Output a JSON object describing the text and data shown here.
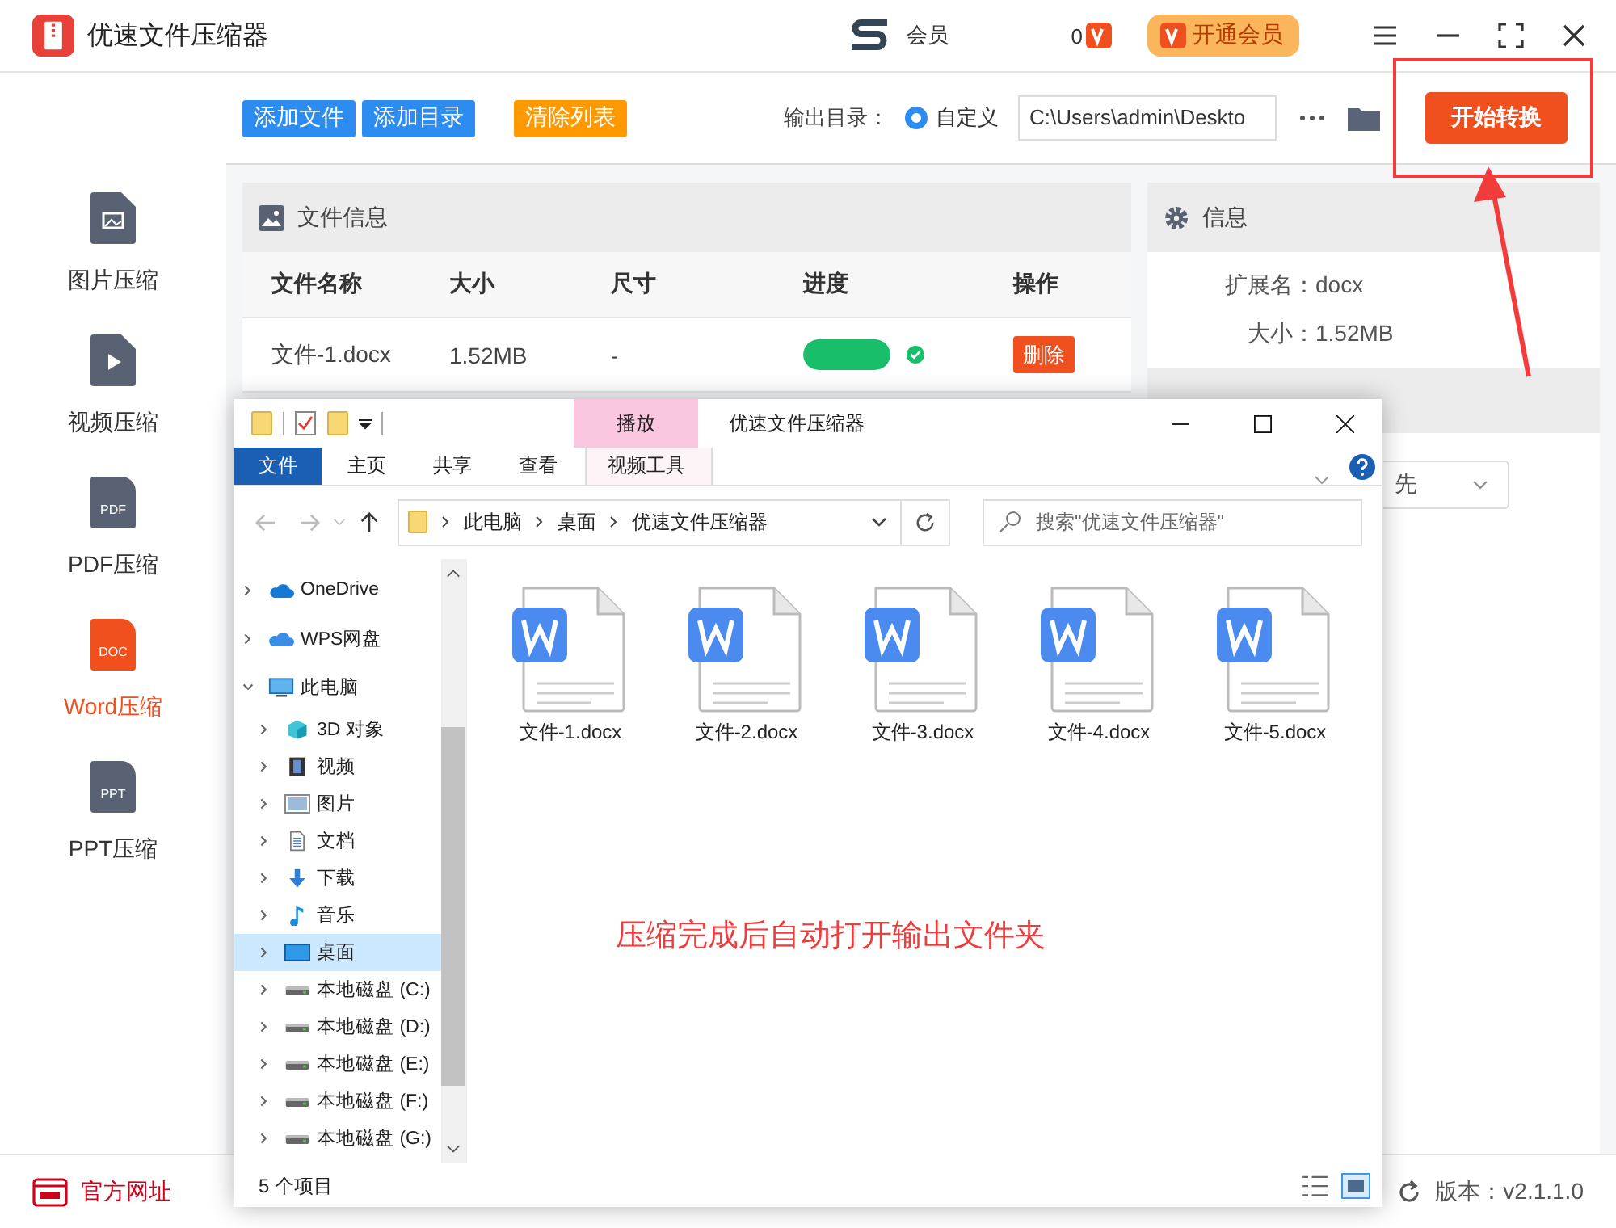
{
  "app": {
    "title": "优速文件压缩器",
    "user_label": "会员",
    "user_tail": "0",
    "vip_button": "开通会员"
  },
  "sidebar": {
    "items": [
      {
        "label": "图片压缩",
        "kind": "image",
        "selected": false
      },
      {
        "label": "视频压缩",
        "kind": "video",
        "selected": false
      },
      {
        "label": "PDF压缩",
        "kind": "doc",
        "icon_text": "PDF",
        "selected": false
      },
      {
        "label": "Word压缩",
        "kind": "doc",
        "icon_text": "DOC",
        "selected": true
      },
      {
        "label": "PPT压缩",
        "kind": "doc",
        "icon_text": "PPT",
        "selected": false
      }
    ]
  },
  "toolbar": {
    "buttons": [
      {
        "label": "添加文件",
        "kind": "primary"
      },
      {
        "label": "添加目录",
        "kind": "primary"
      },
      {
        "label": "清除列表",
        "kind": "warning"
      }
    ],
    "output_label": "输出目录：",
    "output_option": {
      "label": "自定义",
      "selected": true
    },
    "output_path": "C:\\Users\\admin\\Deskto",
    "start_button": "开始转换"
  },
  "file_panel": {
    "title": "文件信息",
    "columns": [
      "文件名称",
      "大小",
      "尺寸",
      "进度",
      "操作"
    ],
    "rows": [
      {
        "name": "文件-1.docx",
        "size": "1.52MB",
        "dimensions": "-",
        "level": 1,
        "done": true,
        "action": "删除"
      }
    ]
  },
  "info_panel": {
    "title": "信息",
    "fields": [
      {
        "label": "扩展名：",
        "value": "docx"
      },
      {
        "label": "大小：",
        "value": "1.52MB"
      }
    ],
    "dropdown_value": "先"
  },
  "footer": {
    "website": "官方网址",
    "version": "版本：v2.1.1.0"
  },
  "explorer": {
    "title": "优速文件压缩器",
    "context_tab": "播放",
    "tabs": [
      {
        "label": "文件",
        "selected": true
      },
      {
        "label": "主页",
        "selected": false
      },
      {
        "label": "共享",
        "selected": false
      },
      {
        "label": "查看",
        "selected": false
      },
      {
        "label": "视频工具",
        "selected": false
      }
    ],
    "breadcrumb": [
      "此电脑",
      "桌面",
      "优速文件压缩器"
    ],
    "search": {
      "placeholder": "搜索\"优速文件压缩器\""
    },
    "nav": [
      {
        "label": "OneDrive",
        "kind": "onedrive",
        "expanded": false,
        "selected": false
      },
      {
        "label": "WPS网盘",
        "kind": "cloud",
        "expanded": false,
        "selected": false
      },
      {
        "label": "此电脑",
        "kind": "pc",
        "expanded": true,
        "selected": false,
        "children": [
          {
            "label": "3D 对象",
            "kind": "cube",
            "expanded": false,
            "selected": false
          },
          {
            "label": "视频",
            "kind": "video",
            "expanded": false,
            "selected": false
          },
          {
            "label": "图片",
            "kind": "pictures",
            "expanded": false,
            "selected": false
          },
          {
            "label": "文档",
            "kind": "docs",
            "expanded": false,
            "selected": false
          },
          {
            "label": "下载",
            "kind": "download",
            "expanded": false,
            "selected": false
          },
          {
            "label": "音乐",
            "kind": "music",
            "expanded": false,
            "selected": false
          },
          {
            "label": "桌面",
            "kind": "desktop",
            "expanded": false,
            "selected": true
          },
          {
            "label": "本地磁盘 (C:)",
            "kind": "drive",
            "expanded": false,
            "selected": false
          },
          {
            "label": "本地磁盘 (D:)",
            "kind": "drive",
            "expanded": false,
            "selected": false
          },
          {
            "label": "本地磁盘 (E:)",
            "kind": "drive",
            "expanded": false,
            "selected": false
          },
          {
            "label": "本地磁盘 (F:)",
            "kind": "drive",
            "expanded": false,
            "selected": false
          },
          {
            "label": "本地磁盘 (G:)",
            "kind": "drive",
            "expanded": false,
            "selected": false
          }
        ]
      }
    ],
    "files": [
      {
        "name": "文件-1.docx"
      },
      {
        "name": "文件-2.docx"
      },
      {
        "name": "文件-3.docx"
      },
      {
        "name": "文件-4.docx"
      },
      {
        "name": "文件-5.docx"
      }
    ],
    "note": "压缩完成后自动打开输出文件夹",
    "status": "5 个项目"
  }
}
